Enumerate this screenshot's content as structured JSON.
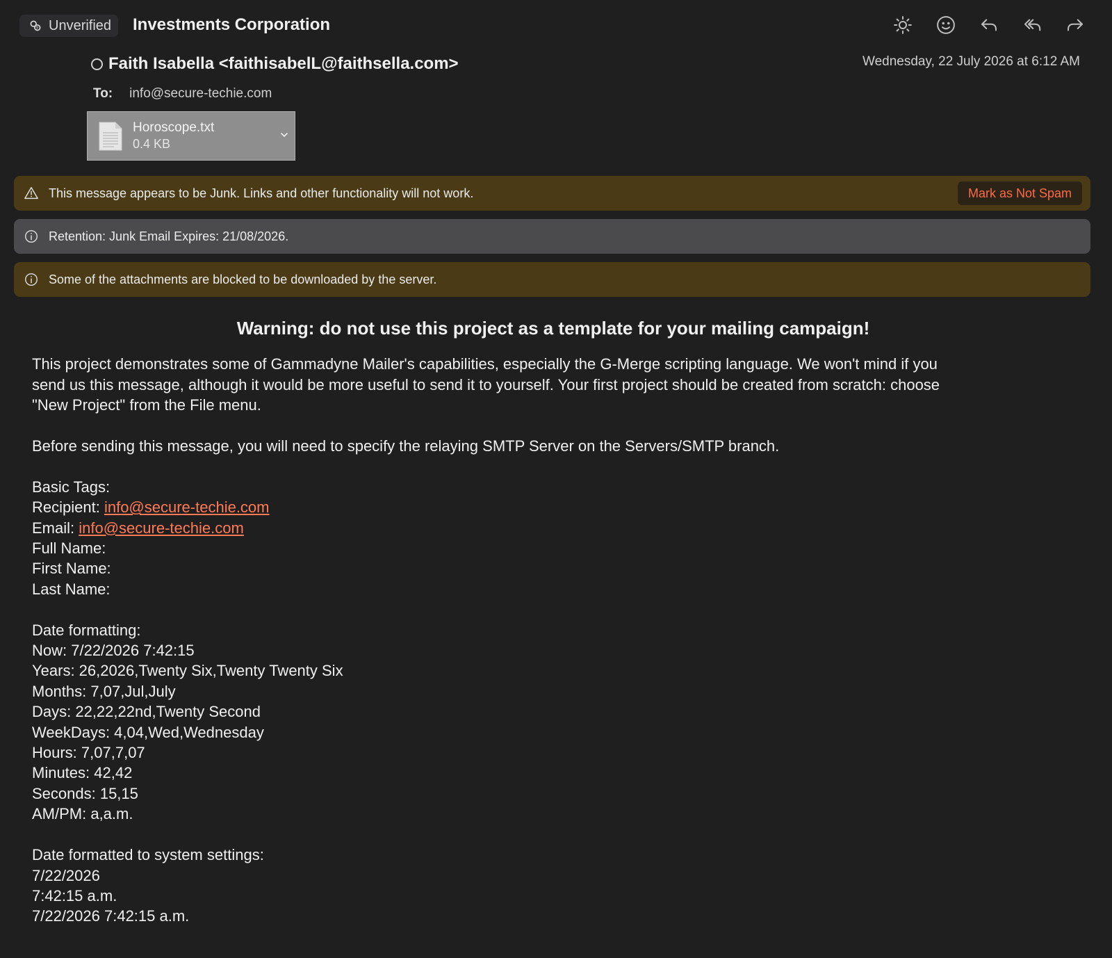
{
  "header": {
    "unverified_label": "Unverified",
    "subject": "Investments Corporation",
    "sender": "Faith Isabella <faithisabelL@faithsella.com>",
    "datetime": "Wednesday, 22 July 2026 at 6:12 AM",
    "to_label": "To:",
    "to_address": "info@secure-techie.com"
  },
  "toolbar": {
    "icons": [
      "brightness-icon",
      "emoji-icon",
      "reply-icon",
      "reply-all-icon",
      "forward-icon"
    ]
  },
  "attachment": {
    "name": "Horoscope.txt",
    "size": "0.4 KB"
  },
  "banners": {
    "junk_text": "This message appears to be Junk. Links and other functionality will not work.",
    "not_spam_label": "Mark as Not Spam",
    "retention_text": "Retention: Junk Email Expires: 21/08/2026.",
    "blocked_text": "Some of the attachments are blocked to be downloaded by the server."
  },
  "colors": {
    "background": "#1f1f1f",
    "junk_banner": "#4a3a15",
    "info_banner": "#4b4b4d",
    "link": "#ff7a55"
  },
  "body": {
    "title": "Warning: do not use this project as a template for your mailing campaign!",
    "intro_l1": "This project demonstrates some of Gammadyne Mailer's capabilities, especially the G-Merge scripting language.  We won't mind if you",
    "intro_l2": "send us this message, although it would be more useful to send it to yourself.  Your first project should be created from scratch:  choose",
    "intro_l3": "\"New Project\" from the File menu.",
    "smtp_note": "Before sending this message, you will need to specify the relaying SMTP Server on the Servers/SMTP branch.",
    "basic_tags_heading": "Basic Tags:",
    "recipient_label": "Recipient: ",
    "recipient_value": "info@secure-techie.com",
    "email_label": "Email: ",
    "email_value": "info@secure-techie.com",
    "full_name": "Full Name:",
    "first_name": "First Name:",
    "last_name": "Last Name:",
    "date_heading": "Date formatting:",
    "date_lines": [
      "Now: 7/22/2026 7:42:15",
      "Years: 26,2026,Twenty Six,Twenty Twenty Six",
      "Months: 7,07,Jul,July",
      "Days: 22,22,22nd,Twenty Second",
      "WeekDays: 4,04,Wed,Wednesday",
      "Hours: 7,07,7,07",
      "Minutes: 42,42",
      "Seconds: 15,15",
      "AM/PM: a,a.m."
    ],
    "system_heading": "Date formatted to system settings:",
    "system_lines": [
      "7/22/2026",
      "7:42:15 a.m.",
      "7/22/2026 7:42:15 a.m."
    ]
  }
}
